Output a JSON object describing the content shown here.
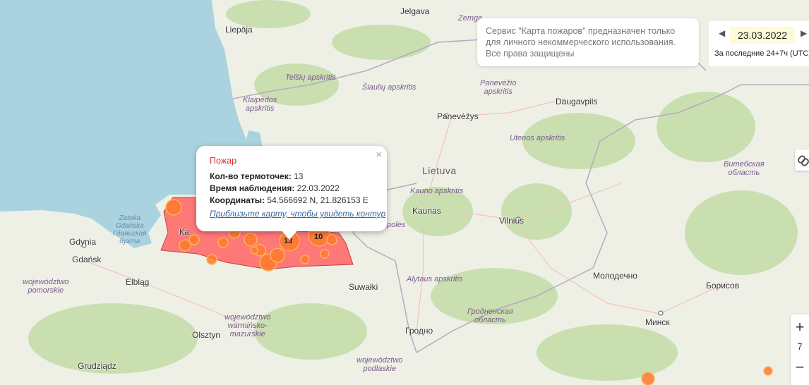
{
  "map": {
    "country_labels": [
      {
        "id": "lietuva",
        "text": "Lietuva"
      }
    ],
    "city_labels": [
      {
        "id": "jelgava",
        "text": "Jelgava"
      },
      {
        "id": "liepaja",
        "text": "Liepāja"
      },
      {
        "id": "panevezys",
        "text": "Panevėžys"
      },
      {
        "id": "daugavpils",
        "text": "Daugavpils"
      },
      {
        "id": "kaunas",
        "text": "Kaunas"
      },
      {
        "id": "vilnius",
        "text": "Vilnius"
      },
      {
        "id": "gdynia",
        "text": "Gdynia"
      },
      {
        "id": "gdansk",
        "text": "Gdańsk"
      },
      {
        "id": "elblag",
        "text": "Elbląg"
      },
      {
        "id": "suwalki",
        "text": "Suwałki"
      },
      {
        "id": "grodno",
        "text": "Гродно"
      },
      {
        "id": "molodechno",
        "text": "Молодечно"
      },
      {
        "id": "borisov",
        "text": "Борисов"
      },
      {
        "id": "minsk",
        "text": "Минск"
      },
      {
        "id": "olsztyn",
        "text": "Olsztyn"
      },
      {
        "id": "grudziadz",
        "text": "Grudziądz"
      },
      {
        "id": "kaliningrad",
        "text": "Ка"
      }
    ],
    "region_labels": [
      {
        "id": "zemgale",
        "text": "Zemga"
      },
      {
        "id": "telsiu",
        "text": "Telšių apskritis"
      },
      {
        "id": "siauliu",
        "text": "Šiaulių apskritis"
      },
      {
        "id": "klaipedos",
        "text": "Klaipėdos\napskritis"
      },
      {
        "id": "panevezio",
        "text": "Panevėžio\napskritis"
      },
      {
        "id": "utenos",
        "text": "Utenos apskritis"
      },
      {
        "id": "kauno",
        "text": "Kauno apskritis"
      },
      {
        "id": "alytaus",
        "text": "Alytaus apskritis"
      },
      {
        "id": "vitebsk",
        "text": "Витебская\nобласть"
      },
      {
        "id": "grodno_obl",
        "text": "Гродненская\nобласть"
      },
      {
        "id": "pomorskie",
        "text": "województwo\npomorskie"
      },
      {
        "id": "warminsko",
        "text": "województwo\nwarmińsko-\nmazurskie"
      },
      {
        "id": "podlaskie",
        "text": "województwo\npodlaskie"
      },
      {
        "id": "marijampoles",
        "text": "polės"
      }
    ],
    "water_labels": [
      {
        "id": "gulf",
        "text": "Zatoka\nGdańska\nГданьская\nбухта"
      }
    ],
    "cluster_labels": [
      {
        "id": "c13",
        "text": "13"
      },
      {
        "id": "c10",
        "text": "10"
      }
    ],
    "colors": {
      "fire": "#ff5a2a",
      "fire_region": "#ff6060",
      "sea": "#aad3df",
      "land": "#eef0e6",
      "forest": "#c9dfb0"
    }
  },
  "notice": {
    "lines": [
      "Сервис \"Карта пожаров\" предназначен только",
      "для личного некоммерческого использования.",
      "Все права защищены"
    ]
  },
  "date_control": {
    "prev_icon": "triangle-left",
    "next_icon": "triangle-right",
    "date": "23.03.2022",
    "period": "За последние 24+7ч (UTC)"
  },
  "zoom": {
    "zoom_in": "+",
    "zoom_out": "−",
    "level": "7"
  },
  "link_icon": "link-icon",
  "popup": {
    "title": "Пожар",
    "close": "×",
    "rows": [
      {
        "label": "Кол-во термоточек:",
        "value": "13"
      },
      {
        "label": "Время наблюдения:",
        "value": "22.03.2022"
      },
      {
        "label": "Координаты:",
        "value": "54.566692 N, 21.826153 E"
      }
    ],
    "link": "Приблизьте карту, чтобы увидеть контур"
  }
}
